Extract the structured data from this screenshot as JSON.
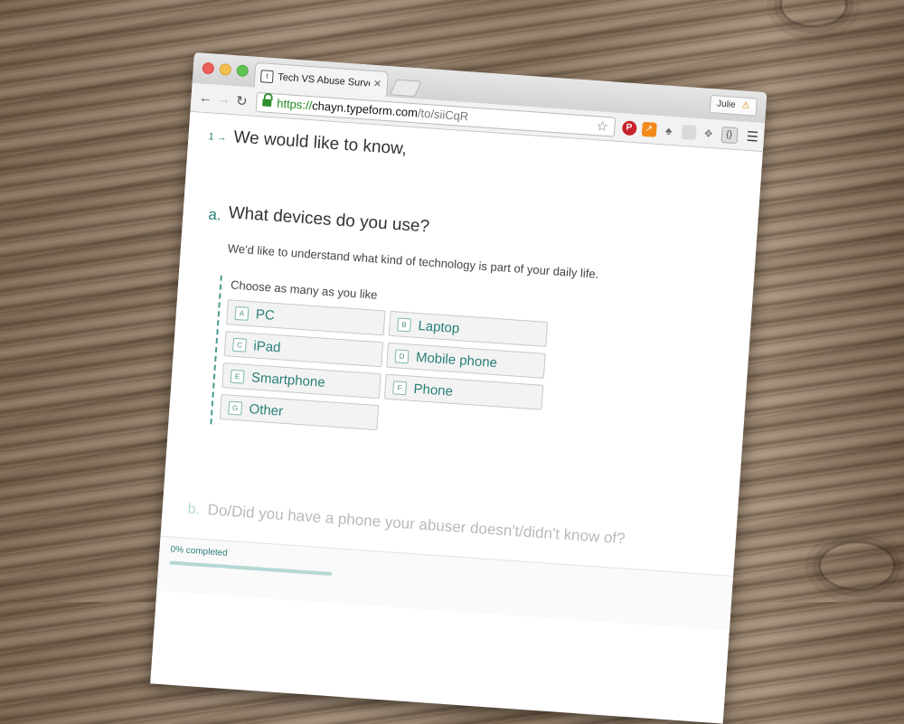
{
  "browser": {
    "tab_title": "Tech VS Abuse Survey",
    "tab_favicon": "t",
    "url_scheme": "https://",
    "url_host": "chayn.typeform.com",
    "url_path": "/to/siiCqR",
    "profile_name": "Julie",
    "extension_icons": [
      "pinterest-icon",
      "analytics-icon",
      "evernote-icon",
      "reader-icon",
      "dropbox-icon",
      "json-icon"
    ]
  },
  "survey": {
    "question_number": "1",
    "question_arrow": "→",
    "intro": "We would like to know,",
    "part_a": {
      "label": "a.",
      "question": "What devices do you use?",
      "description": "We'd like to understand what kind of technology is part of your daily life.",
      "instruction": "Choose as many as you like",
      "choices": [
        {
          "key": "A",
          "label": "PC"
        },
        {
          "key": "B",
          "label": "Laptop"
        },
        {
          "key": "C",
          "label": "iPad"
        },
        {
          "key": "D",
          "label": "Mobile phone"
        },
        {
          "key": "E",
          "label": "Smartphone"
        },
        {
          "key": "F",
          "label": "Phone"
        },
        {
          "key": "G",
          "label": "Other"
        }
      ]
    },
    "part_b": {
      "label": "b.",
      "question": "Do/Did you have a phone your abuser doesn't/didn't know of?"
    },
    "progress": {
      "text": "0% completed",
      "percent": 0
    }
  },
  "colors": {
    "accent": "#2a7f77",
    "accent_light": "#b5d9d4"
  }
}
